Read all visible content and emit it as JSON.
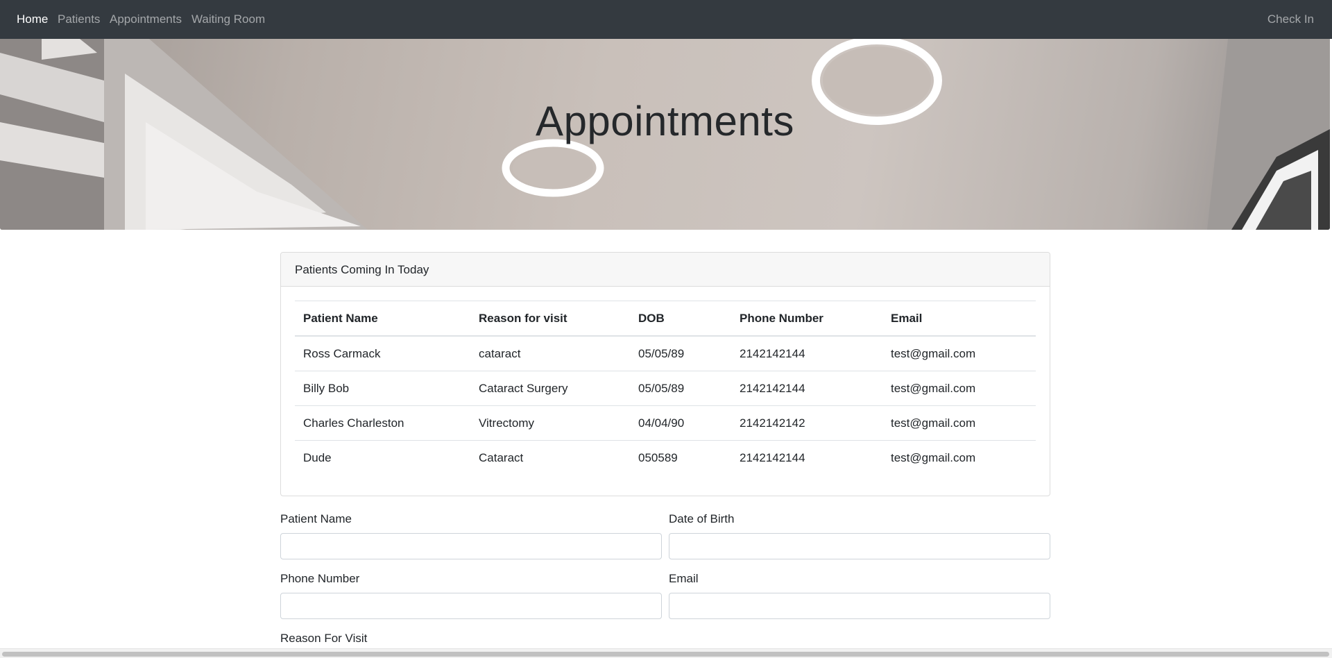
{
  "nav": {
    "items": [
      {
        "label": "Home",
        "active": true
      },
      {
        "label": "Patients",
        "active": false
      },
      {
        "label": "Appointments",
        "active": false
      },
      {
        "label": "Waiting Room",
        "active": false
      }
    ],
    "right_link": "Check In"
  },
  "hero": {
    "title": "Appointments"
  },
  "card": {
    "header": "Patients Coming In Today",
    "columns": [
      "Patient Name",
      "Reason for visit",
      "DOB",
      "Phone Number",
      "Email"
    ],
    "rows": [
      [
        "Ross Carmack",
        "cataract",
        "05/05/89",
        "2142142144",
        "test@gmail.com"
      ],
      [
        "Billy Bob",
        "Cataract Surgery",
        "05/05/89",
        "2142142144",
        "test@gmail.com"
      ],
      [
        "Charles Charleston",
        "Vitrectomy",
        "04/04/90",
        "2142142142",
        "test@gmail.com"
      ],
      [
        "Dude",
        "Cataract",
        "050589",
        "2142142144",
        "test@gmail.com"
      ]
    ]
  },
  "form": {
    "patient_name": {
      "label": "Patient Name",
      "value": ""
    },
    "date_of_birth": {
      "label": "Date of Birth",
      "value": ""
    },
    "phone_number": {
      "label": "Phone Number",
      "value": ""
    },
    "email": {
      "label": "Email",
      "value": ""
    },
    "reason_for_visit": {
      "label": "Reason For Visit"
    }
  },
  "colors": {
    "navbar_bg": "#343a40",
    "nav_active": "#ffffff",
    "nav_inactive": "#9a9da0",
    "card_header_bg": "#f7f7f7"
  }
}
